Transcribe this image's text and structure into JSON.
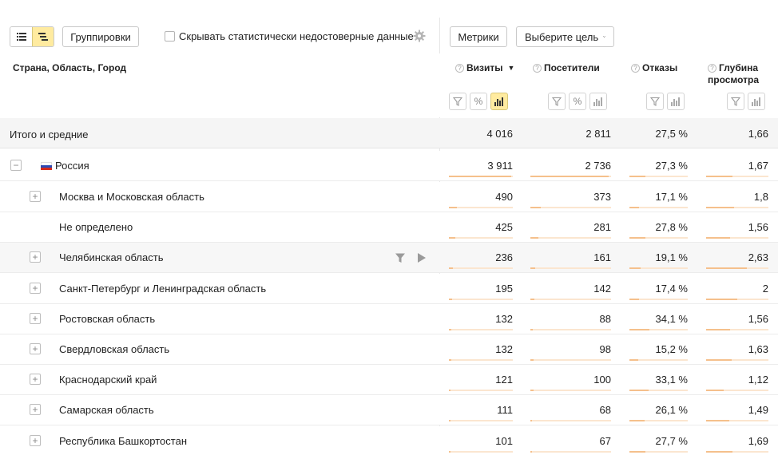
{
  "toolbar": {
    "view_flat_icon": "list-icon",
    "view_tree_icon": "tree-list-icon",
    "groupings_label": "Группировки",
    "hide_unreliable_label": "Скрывать статистически недостоверные данные",
    "hide_unreliable_checked": false,
    "settings_icon": "gear-icon",
    "metrics_label": "Метрики",
    "goal_label": "Выберите цель"
  },
  "table": {
    "dimension_header": "Страна, Область, Город",
    "columns": [
      {
        "key": "visits",
        "label": "Визиты",
        "sorted": "desc",
        "buttons": [
          "filter",
          "percent",
          "chart"
        ],
        "chart_active": true
      },
      {
        "key": "visitors",
        "label": "Посетители",
        "buttons": [
          "filter",
          "percent",
          "chart"
        ]
      },
      {
        "key": "bounce",
        "label": "Отказы",
        "buttons": [
          "filter",
          "chart"
        ]
      },
      {
        "key": "depth",
        "label": "Глубина просмотра",
        "label_line1": "Глубина",
        "label_line2": "просмотра",
        "buttons": [
          "filter",
          "chart"
        ]
      }
    ],
    "total": {
      "label": "Итого и средние",
      "visits": "4 016",
      "visitors": "2 811",
      "bounce": "27,5 %",
      "depth": "1,66"
    },
    "country": {
      "label": "Россия",
      "visits": "3 911",
      "visitors": "2 736",
      "bounce": "27,3 %",
      "depth": "1,67",
      "bars": {
        "visits": 0.97,
        "visitors": 0.97,
        "bounce": 0.27,
        "depth": 0.42
      }
    },
    "rows": [
      {
        "label": "Москва и Московская область",
        "expandable": true,
        "visits": "490",
        "visitors": "373",
        "bounce": "17,1 %",
        "depth": "1,8",
        "bars": {
          "visits": 0.12,
          "visitors": 0.13,
          "bounce": 0.17,
          "depth": 0.45
        }
      },
      {
        "label": "Не определено",
        "expandable": false,
        "visits": "425",
        "visitors": "281",
        "bounce": "27,8 %",
        "depth": "1,56",
        "bars": {
          "visits": 0.105,
          "visitors": 0.1,
          "bounce": 0.28,
          "depth": 0.39
        }
      },
      {
        "label": "Челябинская область",
        "expandable": true,
        "hover": true,
        "visits": "236",
        "visitors": "161",
        "bounce": "19,1 %",
        "depth": "2,63",
        "bars": {
          "visits": 0.06,
          "visitors": 0.057,
          "bounce": 0.19,
          "depth": 0.66
        }
      },
      {
        "label": "Санкт-Петербург и Ленинградская область",
        "expandable": true,
        "visits": "195",
        "visitors": "142",
        "bounce": "17,4 %",
        "depth": "2",
        "bars": {
          "visits": 0.048,
          "visitors": 0.05,
          "bounce": 0.17,
          "depth": 0.5
        }
      },
      {
        "label": "Ростовская область",
        "expandable": true,
        "visits": "132",
        "visitors": "88",
        "bounce": "34,1 %",
        "depth": "1,56",
        "bars": {
          "visits": 0.033,
          "visitors": 0.031,
          "bounce": 0.34,
          "depth": 0.39
        }
      },
      {
        "label": "Свердловская область",
        "expandable": true,
        "visits": "132",
        "visitors": "98",
        "bounce": "15,2 %",
        "depth": "1,63",
        "bars": {
          "visits": 0.033,
          "visitors": 0.035,
          "bounce": 0.15,
          "depth": 0.41
        }
      },
      {
        "label": "Краснодарский край",
        "expandable": true,
        "visits": "121",
        "visitors": "100",
        "bounce": "33,1 %",
        "depth": "1,12",
        "bars": {
          "visits": 0.03,
          "visitors": 0.036,
          "bounce": 0.33,
          "depth": 0.28
        }
      },
      {
        "label": "Самарская область",
        "expandable": true,
        "visits": "111",
        "visitors": "68",
        "bounce": "26,1 %",
        "depth": "1,49",
        "bars": {
          "visits": 0.028,
          "visitors": 0.024,
          "bounce": 0.26,
          "depth": 0.37
        }
      },
      {
        "label": "Республика Башкортостан",
        "expandable": true,
        "visits": "101",
        "visitors": "67",
        "bounce": "27,7 %",
        "depth": "1,69",
        "bars": {
          "visits": 0.025,
          "visitors": 0.024,
          "bounce": 0.28,
          "depth": 0.42
        }
      }
    ],
    "row_actions": {
      "filter_icon": "filter-icon",
      "open_icon": "play-icon"
    },
    "colors": {
      "accent": "#ffeba0",
      "bar_track": "#fbe6d0",
      "bar_fill": "#f5c08c",
      "total_bg": "#f5f5f5"
    }
  }
}
